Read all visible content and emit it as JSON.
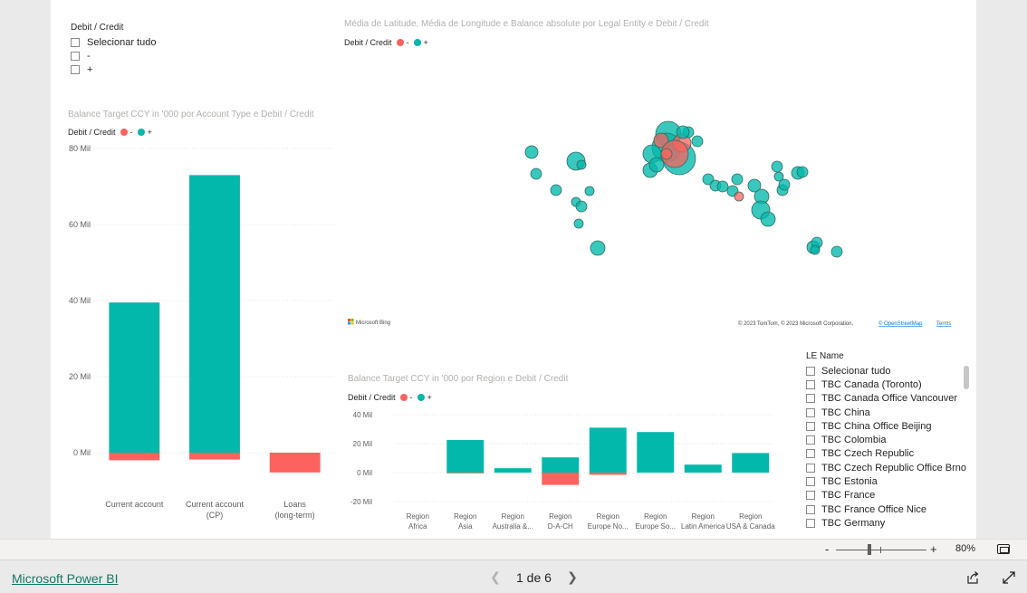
{
  "slicer_top": {
    "header": "Debit / Credit",
    "options": [
      "Selecionar tudo",
      "-",
      "+"
    ]
  },
  "legend": {
    "title": "Debit / Credit",
    "neg_label": "-",
    "pos_label": "+"
  },
  "colors": {
    "negative": "#fd625e",
    "positive": "#01b8aa"
  },
  "map": {
    "title": "Média de Latitude, Média de Longitude e Balance absolute por Legal Entity e Debit / Credit",
    "provider": "Microsoft Bing",
    "copyright": "© 2023 TomTom, © 2023 Microsoft Corporation,",
    "osm_link": "© OpenStreetMap",
    "terms_link": "Terms"
  },
  "chart_account": {
    "title": "Balance Target CCY in '000 por Account Type e Debit / Credit"
  },
  "chart_region": {
    "title": "Balance Target CCY in '000 por Region e Debit / Credit"
  },
  "chart_data": [
    {
      "type": "bar",
      "title": "Balance Target CCY in '000 por Account Type e Debit / Credit",
      "categories": [
        "Current account",
        "Current account (CP)",
        "Loans (long-term)"
      ],
      "series": [
        {
          "name": "-",
          "values": [
            -2000,
            -1800,
            -5200
          ]
        },
        {
          "name": "+",
          "values": [
            39500,
            73000,
            0
          ]
        }
      ],
      "ylim": [
        -5500,
        80000
      ],
      "yticks": [
        0,
        20000,
        40000,
        60000,
        80000
      ],
      "ytick_labels": [
        "0 Mil",
        "20 Mil",
        "40 Mil",
        "60 Mil",
        "80 Mil"
      ],
      "stacked": true
    },
    {
      "type": "bar",
      "title": "Balance Target CCY in '000 por Region e Debit / Credit",
      "categories": [
        "Region Africa",
        "Region Asia",
        "Region Australia &...",
        "Region D-A-CH",
        "Region Europe No...",
        "Region Europe So...",
        "Region Latin America",
        "Region USA & Canada"
      ],
      "series": [
        {
          "name": "-",
          "values": [
            0,
            -500,
            0,
            -8500,
            -1500,
            0,
            0,
            0
          ]
        },
        {
          "name": "+",
          "values": [
            0,
            22500,
            3000,
            10500,
            31000,
            28000,
            5500,
            13500
          ]
        }
      ],
      "ylim": [
        -20000,
        40000
      ],
      "yticks": [
        -20000,
        0,
        20000,
        40000
      ],
      "ytick_labels": [
        "-20 Mil",
        "0 Mil",
        "20 Mil",
        "40 Mil"
      ],
      "stacked": true
    }
  ],
  "le_slicer": {
    "header": "LE Name",
    "options": [
      "Selecionar tudo",
      "TBC Canada (Toronto)",
      "TBC Canada Office Vancouver",
      "TBC China",
      "TBC China Office Beijing",
      "TBC Colombia",
      "TBC Czech Republic",
      "TBC Czech Republic Office Brno",
      "TBC Estonia",
      "TBC France",
      "TBC France Office Nice",
      "TBC Germany"
    ]
  },
  "zoom": {
    "minus": "-",
    "plus": "+",
    "level": "80%"
  },
  "footer": {
    "brand": "Microsoft Power BI",
    "page_label": "1 de 6"
  }
}
